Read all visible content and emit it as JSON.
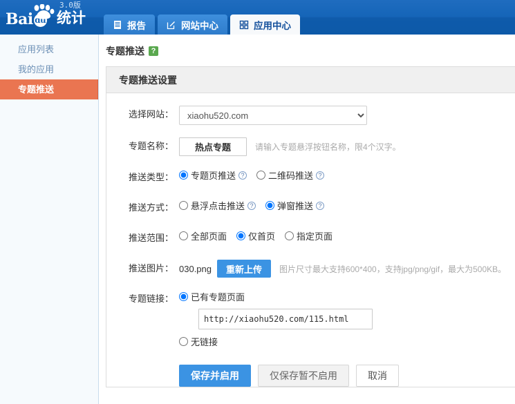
{
  "header": {
    "logo": {
      "brand": "Bai",
      "du": "du",
      "product": "统计",
      "version": "3.0版",
      "paw_icon": "paw-icon"
    },
    "tabs": [
      {
        "label": "报告",
        "icon": "report-list-icon",
        "active": false
      },
      {
        "label": "网站中心",
        "icon": "edit-pencil-icon",
        "active": false
      },
      {
        "label": "应用中心",
        "icon": "grid-apps-icon",
        "active": true
      }
    ]
  },
  "sidebar": {
    "items": [
      {
        "label": "应用列表",
        "active": false
      },
      {
        "label": "我的应用",
        "active": false
      },
      {
        "label": "专题推送",
        "active": true
      }
    ]
  },
  "page": {
    "title": "专题推送",
    "help_badge": "?",
    "panel_title": "专题推送设置"
  },
  "form": {
    "site": {
      "label": "选择网站：",
      "value": "xiaohu520.com",
      "options": [
        "xiaohu520.com"
      ]
    },
    "topic_name": {
      "label": "专题名称：",
      "value": "热点专题",
      "placeholder": "",
      "hint": "请输入专题悬浮按钮名称，限4个汉字。"
    },
    "push_type": {
      "label": "推送类型：",
      "options": [
        {
          "label": "专题页推送",
          "checked": true,
          "info_icon": "question-circle-icon"
        },
        {
          "label": "二维码推送",
          "checked": false,
          "info_icon": "question-circle-icon"
        }
      ]
    },
    "push_mode": {
      "label": "推送方式：",
      "options": [
        {
          "label": "悬浮点击推送",
          "checked": false,
          "info_icon": "question-circle-icon"
        },
        {
          "label": "弹窗推送",
          "checked": true,
          "info_icon": "question-circle-icon"
        }
      ]
    },
    "push_scope": {
      "label": "推送范围：",
      "options": [
        {
          "label": "全部页面",
          "checked": false
        },
        {
          "label": "仅首页",
          "checked": true
        },
        {
          "label": "指定页面",
          "checked": false
        }
      ]
    },
    "push_image": {
      "label": "推送图片：",
      "file_name": "030.png",
      "upload_button": "重新上传",
      "hint": "图片尺寸最大支持600*400，支持jpg/png/gif，最大为500KB。"
    },
    "topic_link": {
      "label": "专题链接：",
      "option_existing": {
        "label": "已有专题页面",
        "checked": true
      },
      "url_value": "http://xiaohu520.com/115.html",
      "url_placeholder": "",
      "option_none": {
        "label": "无链接",
        "checked": false
      }
    },
    "actions": {
      "save_enable": "保存并启用",
      "save_only": "仅保存暂不启用",
      "cancel": "取消"
    }
  },
  "colors": {
    "header_blue": "#1565b8",
    "tab_blue": "#3e8fdd",
    "sidebar_active_orange": "#ea7551",
    "primary_blue": "#3b93e3",
    "help_green": "#5aa84f"
  }
}
